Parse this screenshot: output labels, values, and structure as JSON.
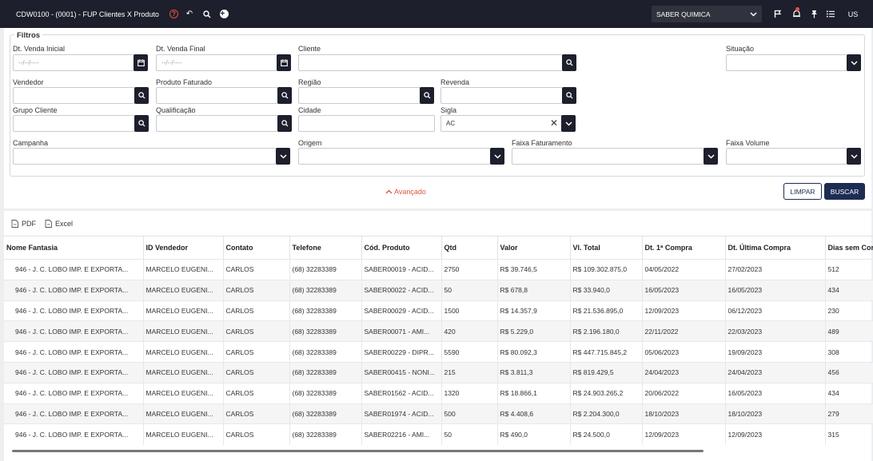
{
  "topbar": {
    "title": "CDW0100 - (0001) - FUP Clientes X Produto",
    "company": "SABER QUIMICA",
    "user": "US"
  },
  "filters": {
    "legend": "Filtros",
    "dt_venda_inicial": {
      "label": "Dt. Venda Inicial",
      "placeholder": "--/--/----"
    },
    "dt_venda_final": {
      "label": "Dt. Venda Final",
      "placeholder": "--/--/----"
    },
    "cliente": {
      "label": "Cliente"
    },
    "situacao": {
      "label": "Situação"
    },
    "vendedor": {
      "label": "Vendedor"
    },
    "produto_faturado": {
      "label": "Produto Faturado"
    },
    "regiao": {
      "label": "Região"
    },
    "revenda": {
      "label": "Revenda"
    },
    "grupo_cliente": {
      "label": "Grupo Cliente"
    },
    "qualificacao": {
      "label": "Qualificação"
    },
    "cidade": {
      "label": "Cidade"
    },
    "sigla": {
      "label": "Sigla",
      "value": "AC"
    },
    "campanha": {
      "label": "Campanha"
    },
    "origem": {
      "label": "Origem"
    },
    "faixa_faturamento": {
      "label": "Faixa Faturamento"
    },
    "faixa_volume": {
      "label": "Faixa Volume"
    }
  },
  "actions": {
    "advanced": "Avançado",
    "clear": "LIMPAR",
    "search": "BUSCAR"
  },
  "export": {
    "pdf": "PDF",
    "excel": "Excel"
  },
  "table": {
    "columns": [
      "Nome Fantasia",
      "ID Vendedor",
      "Contato",
      "Telefone",
      "Cód. Produto",
      "Qtd",
      "Valor",
      "Vl. Total",
      "Dt. 1ª Compra",
      "Dt. Última Compra",
      "Dias sem Cor"
    ],
    "rows": [
      [
        "946 - J. C. LOBO IMP. E EXPORTA...",
        "MARCELO EUGENI...",
        "CARLOS",
        "(68) 32283389",
        "SABER00019 - ACID...",
        "2750",
        "R$ 39.746,5",
        "R$ 109.302.875,0",
        "04/05/2022",
        "27/02/2023",
        "512"
      ],
      [
        "946 - J. C. LOBO IMP. E EXPORTA...",
        "MARCELO EUGENI...",
        "CARLOS",
        "(68) 32283389",
        "SABER00022 - ACID...",
        "50",
        "R$ 678,8",
        "R$ 33.940,0",
        "16/05/2023",
        "16/05/2023",
        "434"
      ],
      [
        "946 - J. C. LOBO IMP. E EXPORTA...",
        "MARCELO EUGENI...",
        "CARLOS",
        "(68) 32283389",
        "SABER00029 - ACID...",
        "1500",
        "R$ 14.357,9",
        "R$ 21.536.895,0",
        "12/09/2023",
        "06/12/2023",
        "230"
      ],
      [
        "946 - J. C. LOBO IMP. E EXPORTA...",
        "MARCELO EUGENI...",
        "CARLOS",
        "(68) 32283389",
        "SABER00071 - AMI...",
        "420",
        "R$ 5.229,0",
        "R$ 2.196.180,0",
        "22/11/2022",
        "22/03/2023",
        "489"
      ],
      [
        "946 - J. C. LOBO IMP. E EXPORTA...",
        "MARCELO EUGENI...",
        "CARLOS",
        "(68) 32283389",
        "SABER00229 - DIPR...",
        "5590",
        "R$ 80.092,3",
        "R$ 447.715.845,2",
        "05/06/2023",
        "19/09/2023",
        "308"
      ],
      [
        "946 - J. C. LOBO IMP. E EXPORTA...",
        "MARCELO EUGENI...",
        "CARLOS",
        "(68) 32283389",
        "SABER00415 - NONI...",
        "215",
        "R$ 3.811,3",
        "R$ 819.429,5",
        "24/04/2023",
        "24/04/2023",
        "456"
      ],
      [
        "946 - J. C. LOBO IMP. E EXPORTA...",
        "MARCELO EUGENI...",
        "CARLOS",
        "(68) 32283389",
        "SABER01562 - ACID...",
        "1320",
        "R$ 18.866,1",
        "R$ 24.903.265,2",
        "20/06/2022",
        "16/05/2023",
        "434"
      ],
      [
        "946 - J. C. LOBO IMP. E EXPORTA...",
        "MARCELO EUGENI...",
        "CARLOS",
        "(68) 32283389",
        "SABER01974 - ACID...",
        "500",
        "R$ 4.408,6",
        "R$ 2.204.300,0",
        "18/10/2023",
        "18/10/2023",
        "279"
      ],
      [
        "946 - J. C. LOBO IMP. E EXPORTA...",
        "MARCELO EUGENI...",
        "CARLOS",
        "(68) 32283389",
        "SABER02216 - AMI...",
        "50",
        "R$ 490,0",
        "R$ 24.500,0",
        "12/09/2023",
        "12/09/2023",
        "315"
      ]
    ]
  }
}
